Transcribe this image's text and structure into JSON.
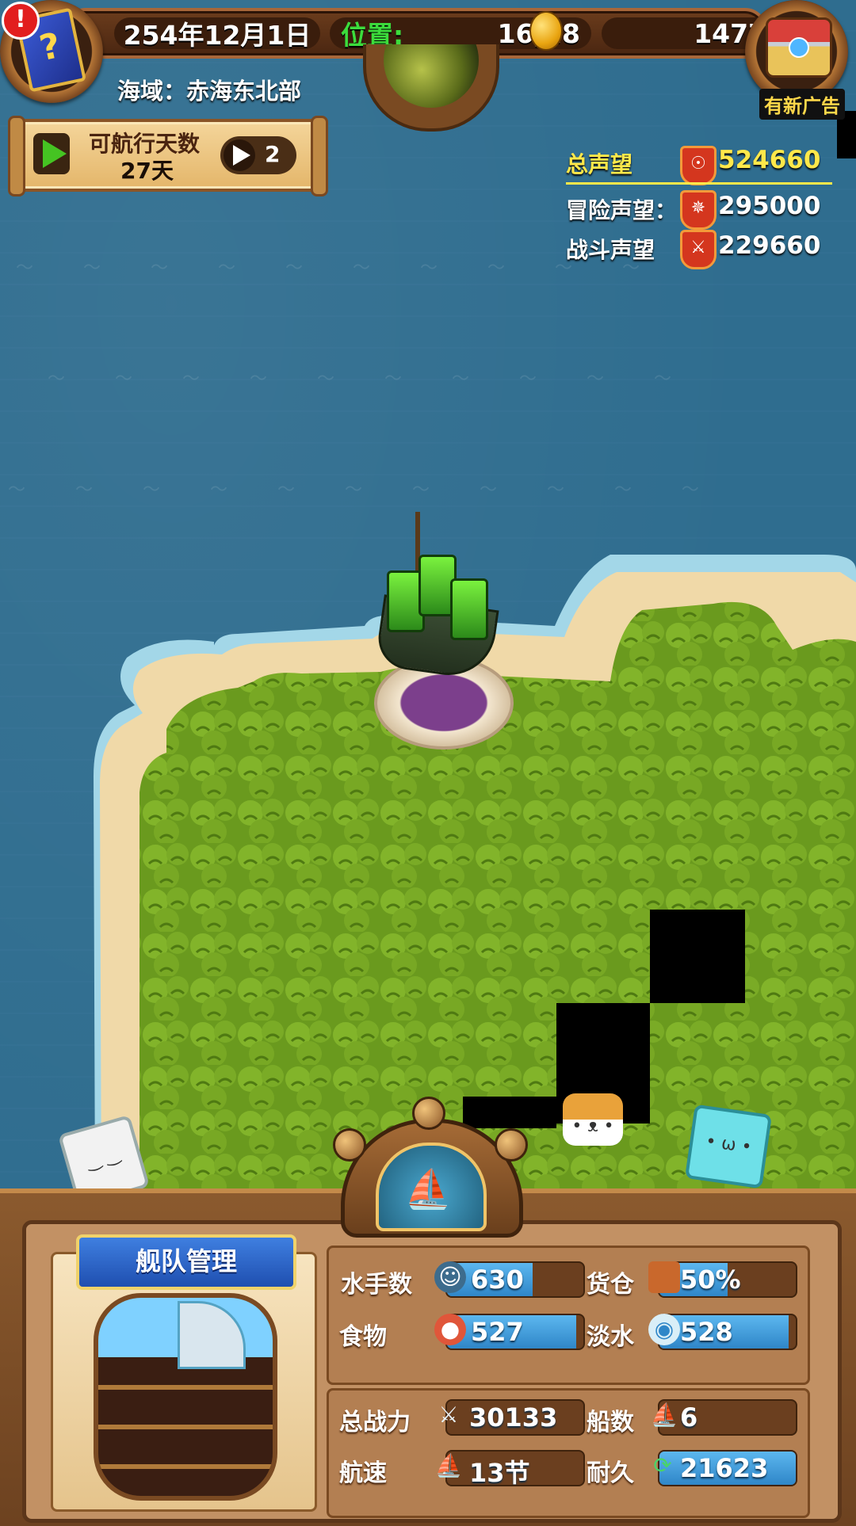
{
  "hud": {
    "date": "254年12月1日",
    "position_label": "位置:",
    "position_value": "16,28",
    "gold": "147723",
    "sea_area": "海域：赤海东北部",
    "ad_label": "有新广告",
    "alert_icon": "!"
  },
  "voyage": {
    "days_label": "可航行天数",
    "days_value": "27天",
    "speed": "2"
  },
  "reputation": {
    "total_label": "总声望",
    "total_value": "524660",
    "adventure_label": "冒险声望：",
    "adventure_value": "295000",
    "battle_label": "战斗声望",
    "battle_value": "229660",
    "colors": {
      "total": "#ffe84a",
      "normal": "#ffffff"
    }
  },
  "fleet": {
    "title": "舰队管理",
    "stats": {
      "sailors_label": "水手数",
      "sailors_value": "630",
      "sailors_fill": 0.63,
      "cargo_label": "货仓",
      "cargo_value": "50%",
      "cargo_fill": 0.5,
      "food_label": "食物",
      "food_value": "527",
      "food_fill": 0.95,
      "water_label": "淡水",
      "water_value": "528",
      "water_fill": 0.95,
      "power_label": "总战力",
      "power_value": "30133",
      "power_fill": 0,
      "ships_label": "船数",
      "ships_value": "6",
      "ships_fill": 0,
      "speed_label": "航速",
      "speed_value": "13节",
      "speed_fill": 0,
      "durability_label": "耐久",
      "durability_value": "21623",
      "durability_fill": 1.0
    }
  },
  "icons": {
    "book": "?",
    "coin": "coin-icon",
    "chest": "treasure-chest-icon",
    "ship": "⛵"
  },
  "colors": {
    "sea": "#2e6a8c",
    "sand": "#f0d9a8",
    "forest": "#6f9e22",
    "wood": "#8b5a2e",
    "bar_fill": "#3f95d6",
    "position_label": "#3cdc3c"
  }
}
